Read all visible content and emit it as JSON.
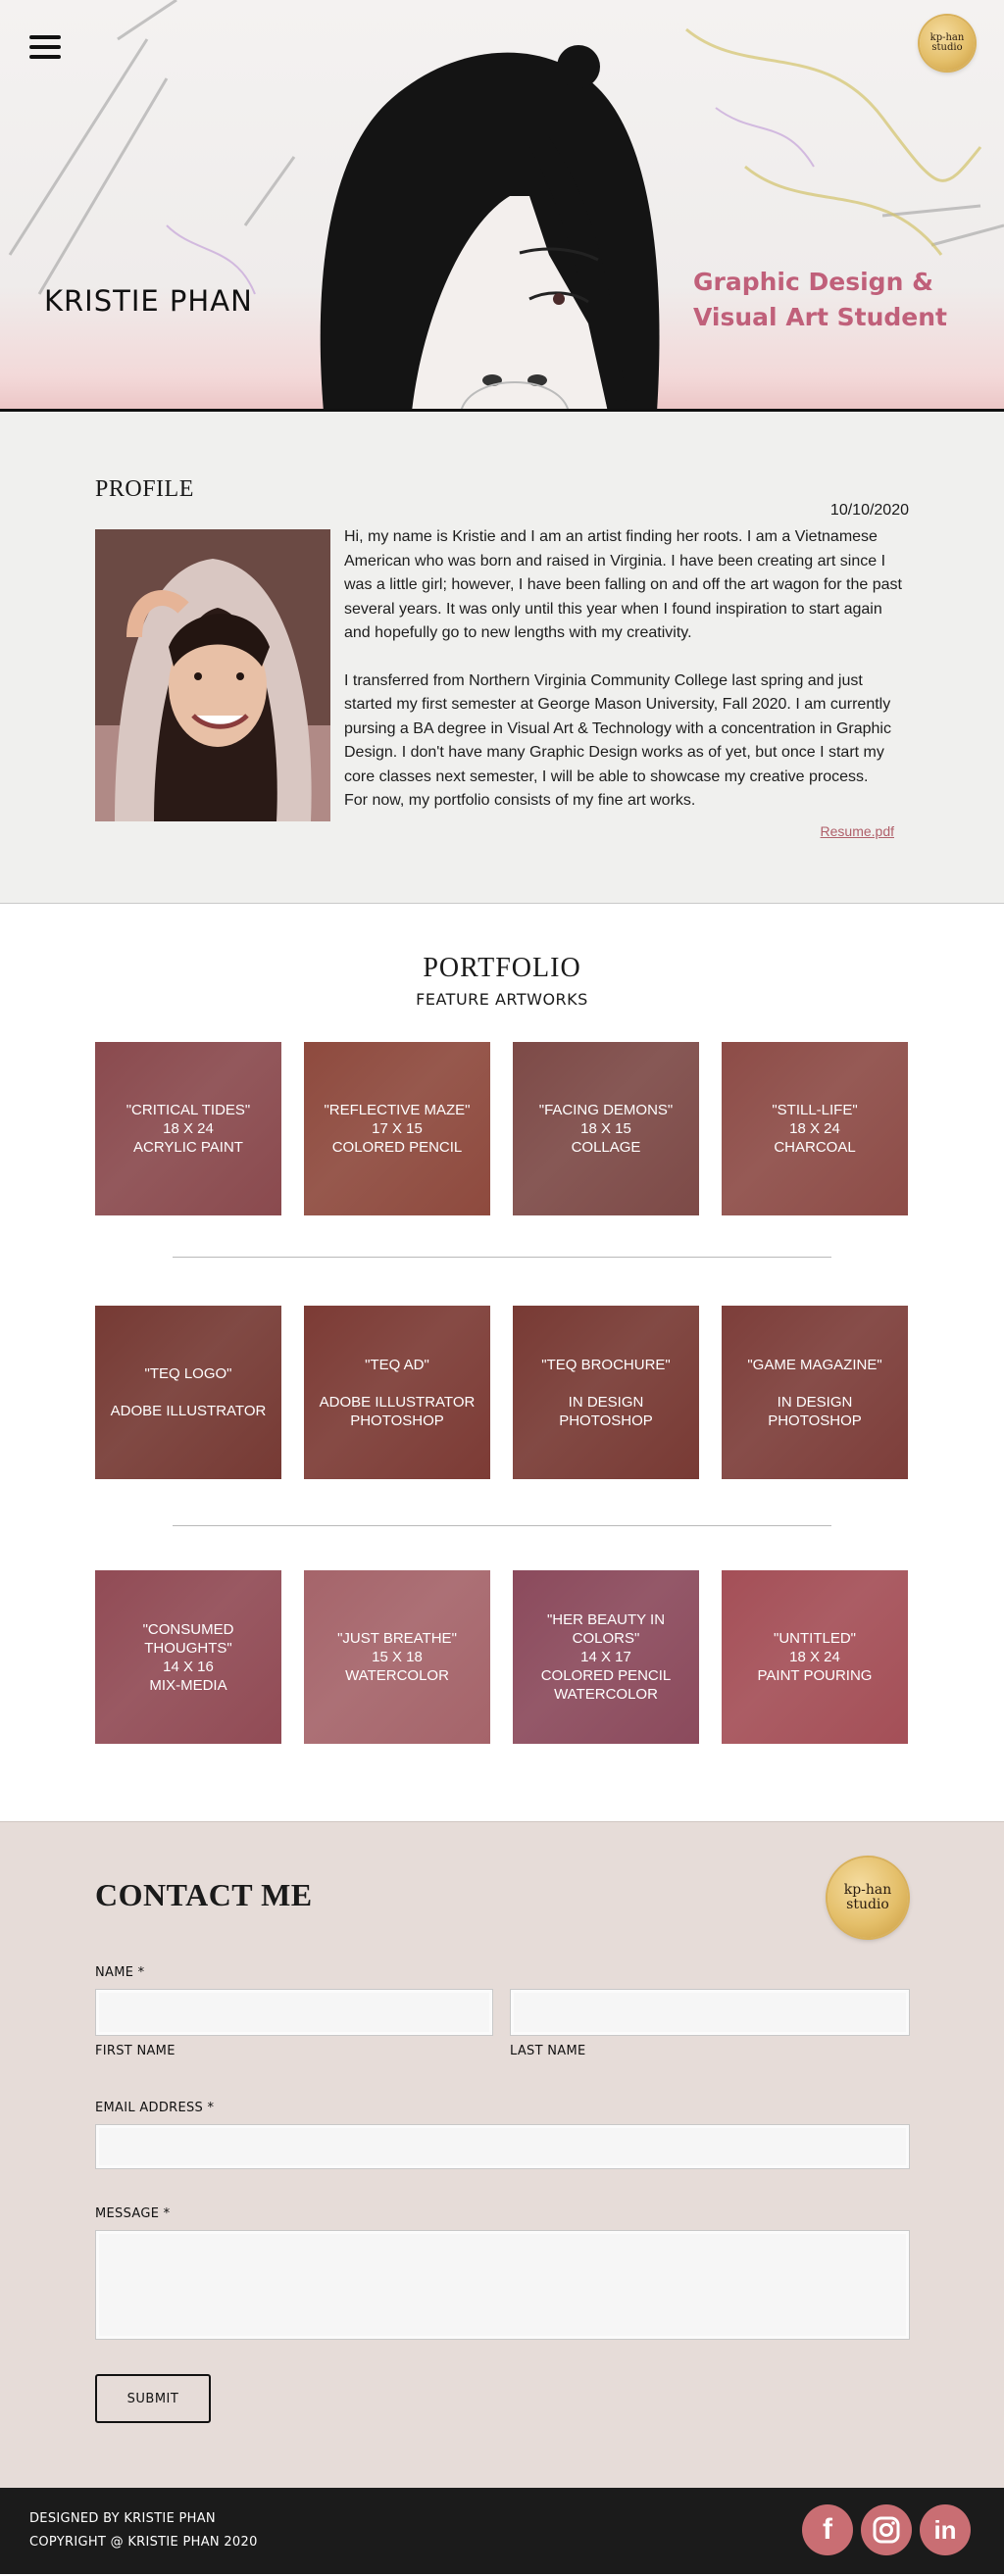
{
  "hero": {
    "name": "KRISTIE PHAN",
    "tagline_line1": "Graphic Design &",
    "tagline_line2": "Visual Art Student",
    "logo_line1": "kp-han",
    "logo_line2": "studio",
    "menu_icon": "hamburger-menu-icon"
  },
  "profile": {
    "heading": "PROFILE",
    "date": "10/10/2020",
    "paragraph1": "Hi, my name is Kristie and I am an artist finding her roots. I am a Vietnamese American who was born and raised in Virginia. I have been creating art since I was a little girl; however, I have been falling on and off the art wagon for the past several years. It was only until this year when I found inspiration to start again and hopefully go to new lengths with my creativity.",
    "paragraph2": "I transferred from Northern Virginia Community College last spring and just started my first semester at George Mason University, Fall 2020. I am currently pursing a BA degree in Visual Art & Technology with a concentration in Graphic Design.  I don't have many Graphic Design works as of yet, but once I start my core classes next semester, I will be able to showcase my creative process.",
    "paragraph3": "For now, my portfolio consists of my fine art works.",
    "resume_link": "Resume.pdf"
  },
  "portfolio": {
    "heading": "PORTFOLIO",
    "subheading": "FEATURE ARTWORKS",
    "rows": [
      [
        {
          "title": "\"CRITICAL TIDES\"",
          "line2": "18 X 24",
          "line3": "ACRYLIC PAINT",
          "line4": "",
          "color": "#8a4a4e"
        },
        {
          "title": "\"REFLECTIVE MAZE\"",
          "line2": "17 X 15",
          "line3": "COLORED PENCIL",
          "line4": "",
          "color": "#8e4a3e"
        },
        {
          "title": "\"FACING DEMONS\"",
          "line2": "18 X 15",
          "line3": "COLLAGE",
          "line4": "",
          "color": "#7d4a47"
        },
        {
          "title": "\"STILL-LIFE\"",
          "line2": "18 X 24",
          "line3": "CHARCOAL",
          "line4": "",
          "color": "#8d4c47"
        }
      ],
      [
        {
          "title": "\"TEQ LOGO\"",
          "line2": "",
          "line3": "ADOBE ILLUSTRATOR",
          "line4": "",
          "color": "#763a34"
        },
        {
          "title": "\"TEQ AD\"",
          "line2": "",
          "line3": "ADOBE ILLUSTRATOR",
          "line4": "PHOTOSHOP",
          "color": "#7c3b35"
        },
        {
          "title": "\"TEQ BROCHURE\"",
          "line2": "",
          "line3": "IN DESIGN",
          "line4": "PHOTOSHOP",
          "color": "#783a34"
        },
        {
          "title": "\"GAME MAGAZINE\"",
          "line2": "",
          "line3": "IN DESIGN",
          "line4": "PHOTOSHOP",
          "color": "#7d3e3a"
        }
      ],
      [
        {
          "title": "\"CONSUMED THOUGHTS\"",
          "line2": "14 X 16",
          "line3": "MIX-MEDIA",
          "line4": "",
          "color": "#914b55"
        },
        {
          "title": "\"JUST BREATHE\"",
          "line2": "15 X 18",
          "line3": "WATERCOLOR",
          "line4": "",
          "color": "#a5646a"
        },
        {
          "title": "\"HER BEAUTY IN COLORS\"",
          "line2": "14 X 17",
          "line3": "COLORED PENCIL",
          "line4": "WATERCOLOR",
          "color": "#8b4a5c"
        },
        {
          "title": "\"UNTITLED\"",
          "line2": "18 X 24",
          "line3": "PAINT POURING",
          "line4": "",
          "color": "#a44f57"
        }
      ]
    ]
  },
  "contact": {
    "heading": "CONTACT ME",
    "name_label": "NAME *",
    "first_name_label": "FIRST NAME",
    "last_name_label": "LAST NAME",
    "email_label": "EMAIL ADDRESS *",
    "message_label": "MESSAGE *",
    "submit_label": "SUBMIT",
    "logo_line1": "kp-han",
    "logo_line2": "studio"
  },
  "footer": {
    "designed_by": "DESIGNED BY KRISTIE PHAN",
    "copyright": "COPYRIGHT @ KRISTIE PHAN 2020",
    "social": [
      {
        "icon": "facebook-icon",
        "glyph": "f"
      },
      {
        "icon": "instagram-icon",
        "glyph": ""
      },
      {
        "icon": "linkedin-icon",
        "glyph": "in"
      }
    ],
    "accent_color": "#c96e73"
  }
}
